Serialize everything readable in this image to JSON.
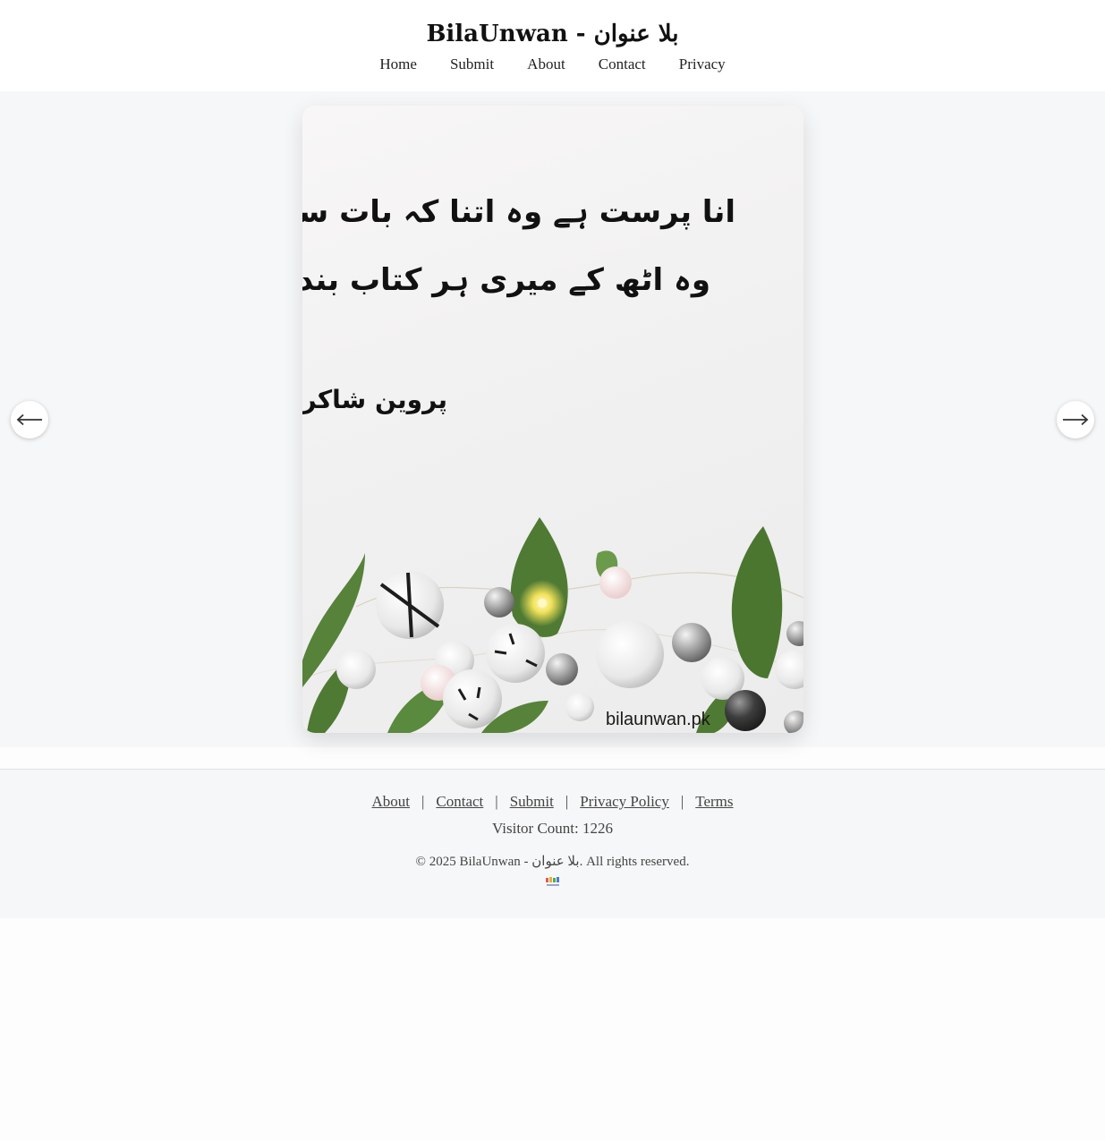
{
  "site": {
    "title": "BilaUnwan - بلا عنوان"
  },
  "nav": {
    "items": [
      "Home",
      "Submit",
      "About",
      "Contact",
      "Privacy"
    ]
  },
  "slide": {
    "poem_line_1": "انا پرست ہے وہ اتنا کہ بات سے پہلے",
    "poem_line_2": "وہ اٹھ کے میری ہر کتاب بند کر دے گا",
    "poet": "پروین شاکر",
    "watermark": "bilaunwan.pk"
  },
  "carousel": {
    "prev_icon": "arrow-left-icon",
    "next_icon": "arrow-right-icon",
    "prev_label": "←",
    "next_label": "→"
  },
  "footer": {
    "links": [
      "About",
      "Contact",
      "Submit",
      "Privacy Policy",
      "Terms"
    ],
    "separator": "|",
    "visitor_count": "Visitor Count: 1226",
    "copyright": "© 2025 BilaUnwan - بلا عنوان. All rights reserved."
  },
  "colors": {
    "page_background": "#fdfdfd",
    "stage_background": "#f6f7f8",
    "leaf_green": "#4f7a33"
  }
}
